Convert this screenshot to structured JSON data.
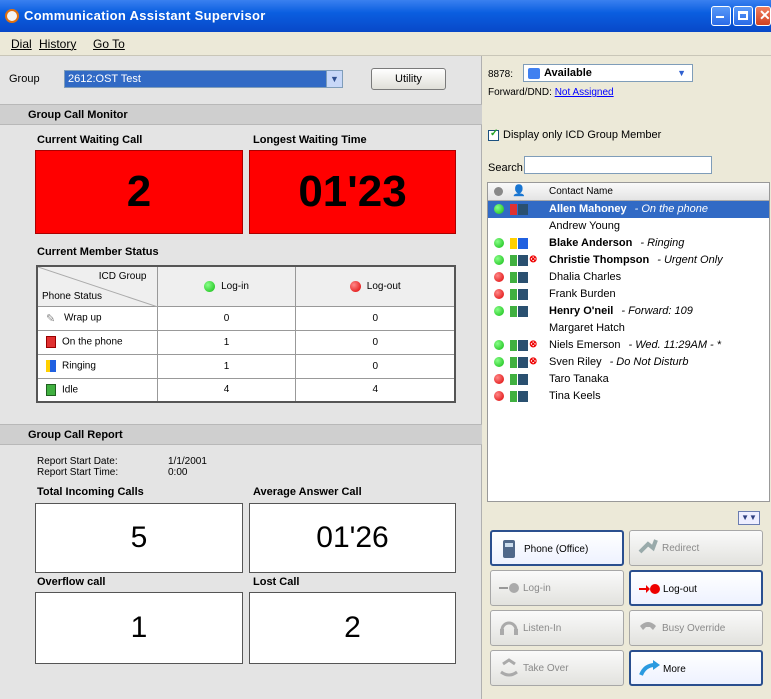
{
  "window": {
    "title": "Communication Assistant Supervisor"
  },
  "menu": [
    "Dial",
    "History",
    "Go To"
  ],
  "group": {
    "label": "Group",
    "value": "2612:OST Test",
    "utility": "Utility"
  },
  "monitor": {
    "title": "Group Call Monitor",
    "waiting_label": "Current Waiting Call",
    "waiting_value": "2",
    "longest_label": "Longest Waiting Time",
    "longest_value": "01'23",
    "member_label": "Current Member Status",
    "header_icd": "ICD Group",
    "header_phone": "Phone Status",
    "col_login": "Log-in",
    "col_logout": "Log-out",
    "rows": [
      {
        "status": "Wrap up",
        "login": "0",
        "logout": "0"
      },
      {
        "status": "On the phone",
        "login": "1",
        "logout": "0"
      },
      {
        "status": "Ringing",
        "login": "1",
        "logout": "0"
      },
      {
        "status": "Idle",
        "login": "4",
        "logout": "4"
      }
    ]
  },
  "report": {
    "title": "Group Call Report",
    "start_date_label": "Report Start Date:",
    "start_date": "1/1/2001",
    "start_time_label": "Report Start Time:",
    "start_time": "0:00",
    "incoming_label": "Total Incoming Calls",
    "incoming_value": "5",
    "answer_label": "Average Answer Call",
    "answer_value": "01'26",
    "overflow_label": "Overflow call",
    "overflow_value": "1",
    "lost_label": "Lost Call",
    "lost_value": "2"
  },
  "presence": {
    "ext": "8878:",
    "status": "Available",
    "fwd_label": "Forward/DND:",
    "fwd_link": "Not Assigned"
  },
  "filter": {
    "label": "Display only ICD Group Member",
    "search_label": "Search"
  },
  "contacts": {
    "header": "Contact Name",
    "rows": [
      {
        "name": "Allen Mahoney",
        "note": "- On the phone"
      },
      {
        "name": "Andrew Young",
        "note": ""
      },
      {
        "name": "Blake Anderson",
        "note": "- Ringing"
      },
      {
        "name": "Christie Thompson",
        "note": "- Urgent Only"
      },
      {
        "name": "Dhalia Charles",
        "note": ""
      },
      {
        "name": "Frank Burden",
        "note": ""
      },
      {
        "name": "Henry O'neil",
        "note": "- Forward: 109"
      },
      {
        "name": "Margaret Hatch",
        "note": ""
      },
      {
        "name": "Niels Emerson",
        "note": "- Wed. 11:29AM - *"
      },
      {
        "name": "Sven Riley",
        "note": "- Do Not Disturb"
      },
      {
        "name": "Taro Tanaka",
        "note": ""
      },
      {
        "name": "Tina Keels",
        "note": ""
      }
    ]
  },
  "actions": [
    "Phone (Office)",
    "Redirect",
    "Log-in",
    "Log-out",
    "Listen-In",
    "Busy Override",
    "Take Over",
    "More"
  ],
  "colors": {
    "red_panel": "#ff0000",
    "selection": "#316ac5",
    "title_bar": "#0a5ee0",
    "online": "#21c121",
    "offline": "#e01010"
  }
}
